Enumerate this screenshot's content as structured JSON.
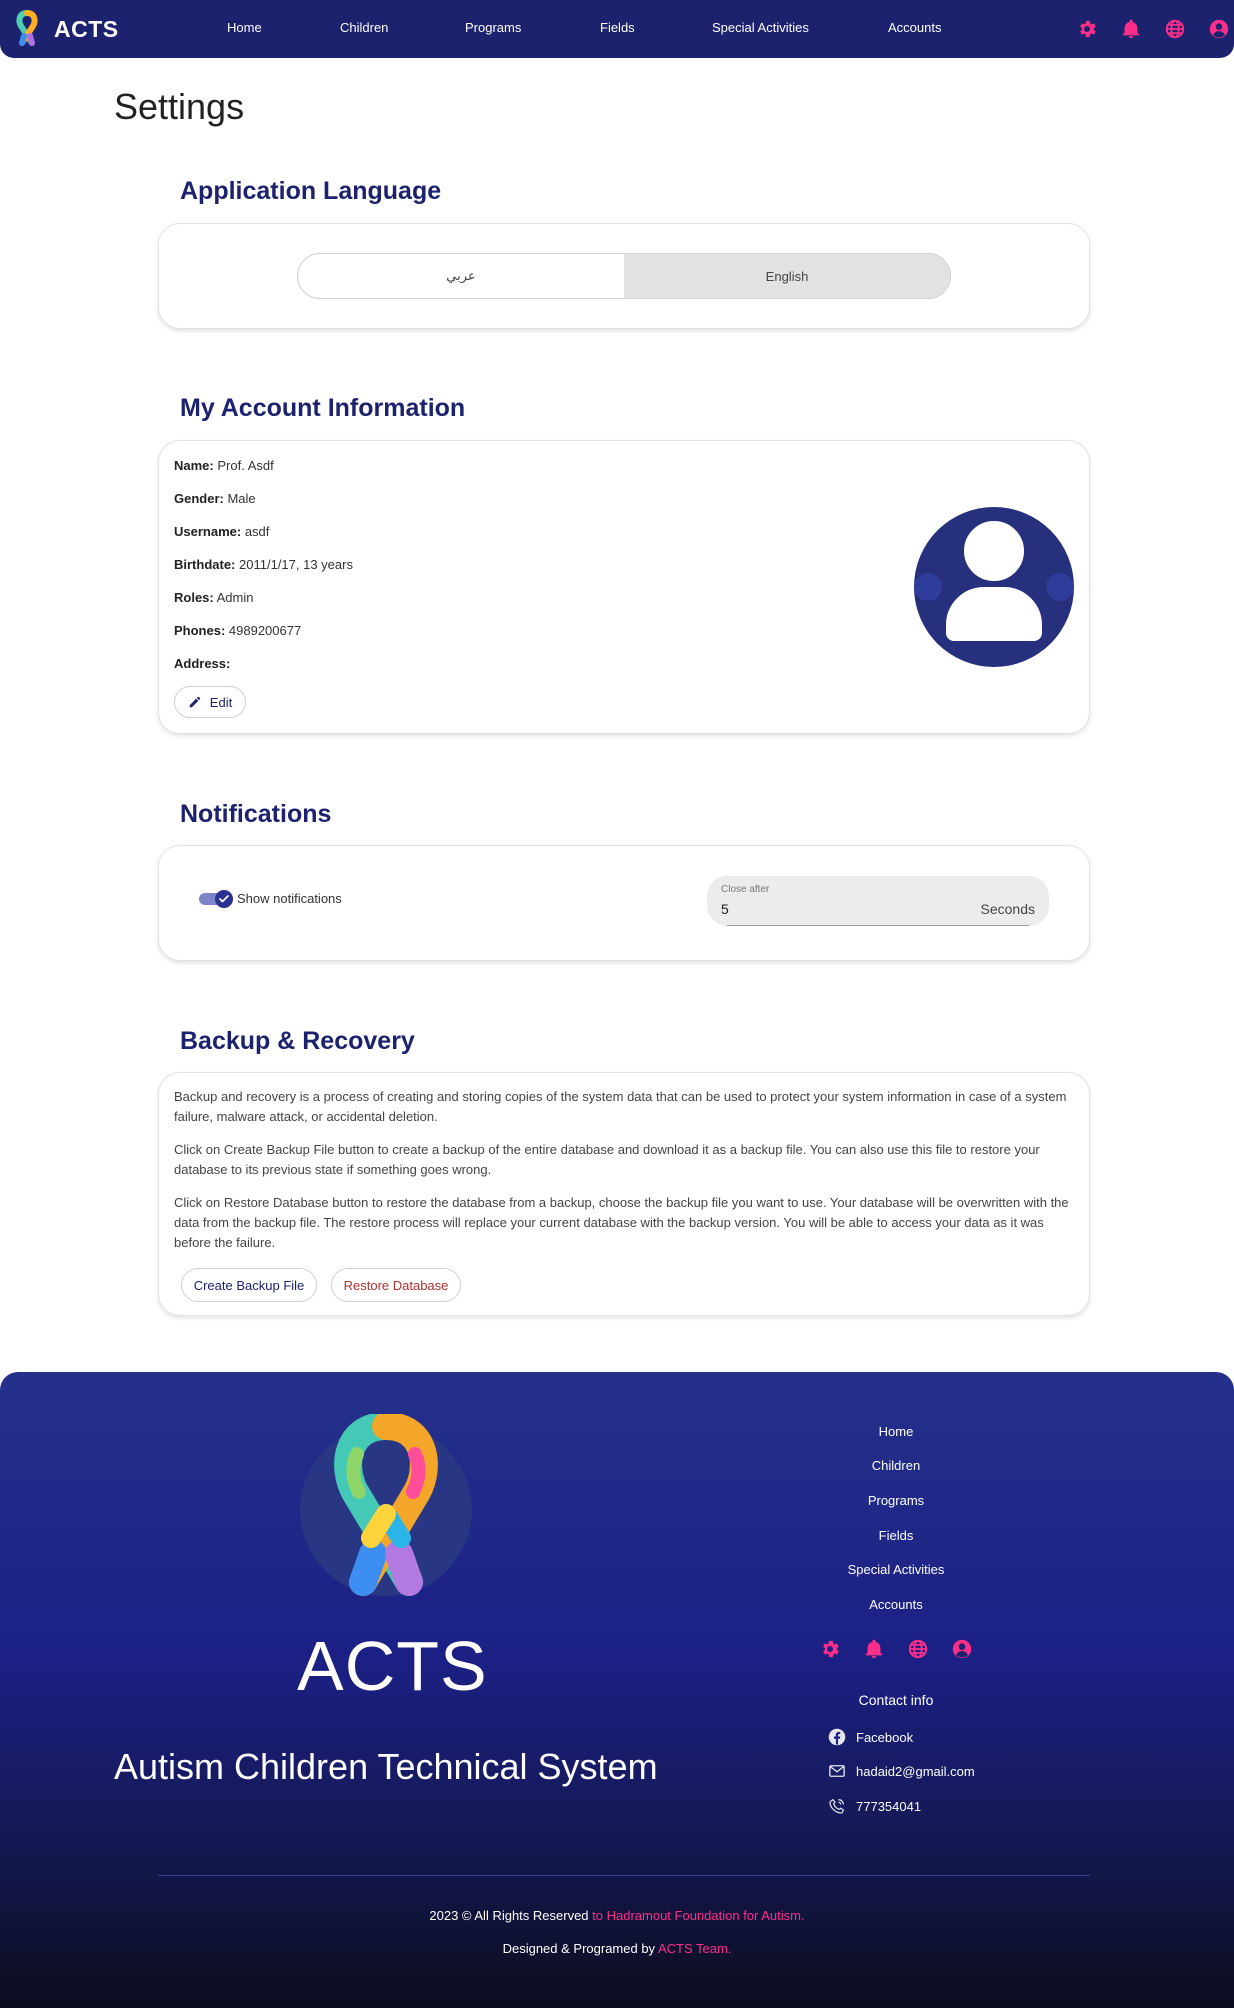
{
  "colors": {
    "primary": "#1c226e",
    "accent": "#ff2e8a",
    "danger": "#b0302f"
  },
  "nav": {
    "brand": "ACTS",
    "links": [
      "Home",
      "Children",
      "Programs",
      "Fields",
      "Special Activities",
      "Accounts"
    ],
    "icons": [
      "gear-icon",
      "bell-icon",
      "globe-icon",
      "user-icon"
    ]
  },
  "page": {
    "title": "Settings"
  },
  "language": {
    "title": "Application Language",
    "options": [
      "عربي",
      "English"
    ],
    "selected": "English"
  },
  "account": {
    "title": "My Account Information",
    "fields": [
      {
        "label": "Name:",
        "value": " Prof. Asdf"
      },
      {
        "label": "Gender:",
        "value": " Male"
      },
      {
        "label": "Username:",
        "value": " asdf"
      },
      {
        "label": "Birthdate:",
        "value": " 2011/1/17, 13 years"
      },
      {
        "label": "Roles:",
        "value": " Admin"
      },
      {
        "label": "Phones:",
        "value": " 4989200677"
      },
      {
        "label": "Address:",
        "value": ""
      }
    ],
    "edit_label": "Edit"
  },
  "notifications": {
    "title": "Notifications",
    "show_label": "Show notifications",
    "show_enabled": true,
    "close_after_label": "Close after",
    "close_after_value": "5",
    "close_after_unit": "Seconds"
  },
  "backup": {
    "title": "Backup & Recovery",
    "paragraphs": [
      "Backup and recovery is a process of creating and storing copies of the system data that can be used to protect your system information in case of a system failure, malware attack, or accidental deletion.",
      "Click on Create Backup File button to create a backup of the entire database and download it as a backup file. You can also use this file to restore your database to its previous state if something goes wrong.",
      "Click on Restore Database button to restore the database from a backup, choose the backup file you want to use. Your database will be overwritten with the data from the backup file. The restore process will replace your current database with the backup version. You will be able to access your data as it was before the failure."
    ],
    "create_label": "Create Backup File",
    "restore_label": "Restore Database"
  },
  "footer": {
    "brand": "ACTS",
    "tagline": "Autism Children Technical System",
    "links": [
      "Home",
      "Children",
      "Programs",
      "Fields",
      "Special Activities",
      "Accounts"
    ],
    "contact_title": "Contact info",
    "contacts": [
      {
        "icon": "facebook-icon",
        "text": "Facebook"
      },
      {
        "icon": "mail-icon",
        "text": "hadaid2@gmail.com"
      },
      {
        "icon": "phone-icon",
        "text": "777354041"
      }
    ],
    "copyright_prefix": "2023 ©  All Rights Reserved",
    "copyright_org": " to Hadramout Foundation for Autism.",
    "designed_prefix": "Designed & Programed by",
    "designed_team": " ACTS Team."
  }
}
